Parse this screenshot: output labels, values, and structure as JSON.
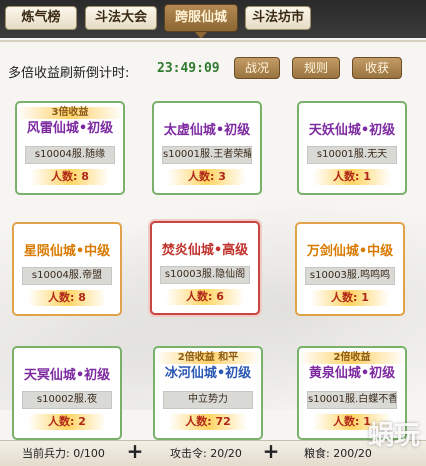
{
  "tabs": [
    {
      "label": "炼气榜",
      "active": false
    },
    {
      "label": "斗法大会",
      "active": false
    },
    {
      "label": "跨服仙城",
      "active": true
    },
    {
      "label": "斗法坊市",
      "active": false
    }
  ],
  "timer": {
    "label": "多倍收益刷新倒计时:",
    "value": "23:49:09"
  },
  "buttons": {
    "war": "战况",
    "rules": "规则",
    "harvest": "收获"
  },
  "cities": [
    {
      "badge": "3倍收益",
      "name": "风雷仙城•初级",
      "server": "s10004服.随缘",
      "people": "人数: 8"
    },
    {
      "badge": "",
      "name": "太虚仙城•初级",
      "server": "s10001服.王者荣耀",
      "people": "人数: 3"
    },
    {
      "badge": "",
      "name": "天妖仙城•初级",
      "server": "s10001服.无天",
      "people": "人数: 1"
    },
    {
      "badge": "",
      "name": "星陨仙城•中级",
      "server": "s10004服.帝盟",
      "people": "人数: 8"
    },
    {
      "badge": "",
      "name": "焚炎仙城•高级",
      "server": "s10003服.隐仙阁",
      "people": "人数: 6"
    },
    {
      "badge": "",
      "name": "万剑仙城•中级",
      "server": "s10003服.鸣鸣鸣",
      "people": "人数: 1"
    },
    {
      "badge": "",
      "name": "天冥仙城•初级",
      "server": "s10002服.夜",
      "people": "人数: 2"
    },
    {
      "badge": "2倍收益  和平",
      "name": "冰河仙城•初级",
      "server": "中立势力",
      "people": "人数: 72"
    },
    {
      "badge": "2倍收益",
      "name": "黄泉仙城•初级",
      "server": "s10001服.白蝶不香鸣",
      "people": "人数: 1"
    }
  ],
  "status": {
    "troops": "当前兵力: 0/100",
    "attack": "攻击令: 20/20",
    "food": "粮食: 200/20"
  },
  "watermark": "蜗玩",
  "colors": {
    "tab_active": "#8c6633",
    "card_green": "#79b06a",
    "card_orange": "#e1a24a",
    "card_red": "#c7463f",
    "name_purple": "#7d2aa0",
    "name_orange": "#d97a00",
    "name_red": "#c0322b",
    "name_blue": "#2a57b3",
    "timer": "#2f7a2f"
  }
}
